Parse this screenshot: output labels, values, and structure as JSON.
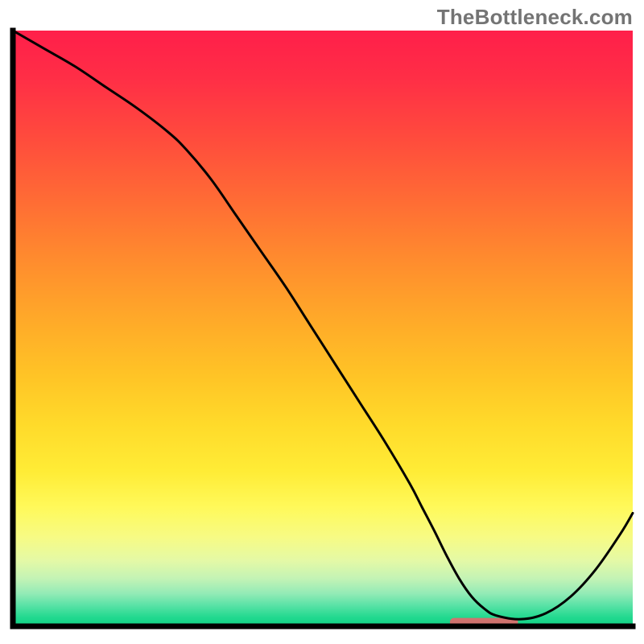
{
  "watermark": "TheBottleneck.com",
  "chart_data": {
    "type": "line",
    "title": "",
    "xlabel": "",
    "ylabel": "",
    "xlim": [
      0,
      100
    ],
    "ylim": [
      0,
      100
    ],
    "x": [
      0,
      5,
      10,
      15,
      20,
      25,
      28,
      32,
      36,
      40,
      44,
      48,
      52,
      56,
      60,
      64,
      66,
      68,
      70,
      72,
      74,
      76,
      78,
      82,
      86,
      90,
      94,
      98,
      100
    ],
    "values": [
      100,
      97,
      94,
      90.5,
      87,
      83,
      80,
      75,
      69,
      63,
      57,
      50.5,
      44,
      37.5,
      31,
      24,
      20,
      16,
      11.8,
      8,
      5,
      3,
      1.8,
      1.2,
      2.2,
      5,
      9.5,
      15.5,
      19
    ],
    "gradient_stops": [
      {
        "offset": 0.0,
        "color": "#ff1f4a"
      },
      {
        "offset": 0.08,
        "color": "#ff2e46"
      },
      {
        "offset": 0.18,
        "color": "#ff4b3d"
      },
      {
        "offset": 0.28,
        "color": "#ff6a35"
      },
      {
        "offset": 0.38,
        "color": "#ff8a2e"
      },
      {
        "offset": 0.48,
        "color": "#ffa829"
      },
      {
        "offset": 0.58,
        "color": "#ffc426"
      },
      {
        "offset": 0.66,
        "color": "#ffda2a"
      },
      {
        "offset": 0.74,
        "color": "#ffec36"
      },
      {
        "offset": 0.8,
        "color": "#fff95a"
      },
      {
        "offset": 0.85,
        "color": "#f7fb84"
      },
      {
        "offset": 0.89,
        "color": "#e4f9a6"
      },
      {
        "offset": 0.92,
        "color": "#c3f3b5"
      },
      {
        "offset": 0.945,
        "color": "#93ebb6"
      },
      {
        "offset": 0.965,
        "color": "#59e2a6"
      },
      {
        "offset": 0.985,
        "color": "#22d98f"
      },
      {
        "offset": 1.0,
        "color": "#0fd185"
      }
    ],
    "marker": {
      "x_center": 76,
      "x_halfwidth": 5.5,
      "height_pct": 1.4,
      "color": "#d0736f",
      "rx": 5
    },
    "axes": {
      "color": "#000000",
      "width": 7,
      "left_inset": 16,
      "right_inset": 14,
      "top_inset": 38,
      "bottom_inset": 22
    },
    "curve_style": {
      "color": "#000000",
      "width": 3
    }
  }
}
